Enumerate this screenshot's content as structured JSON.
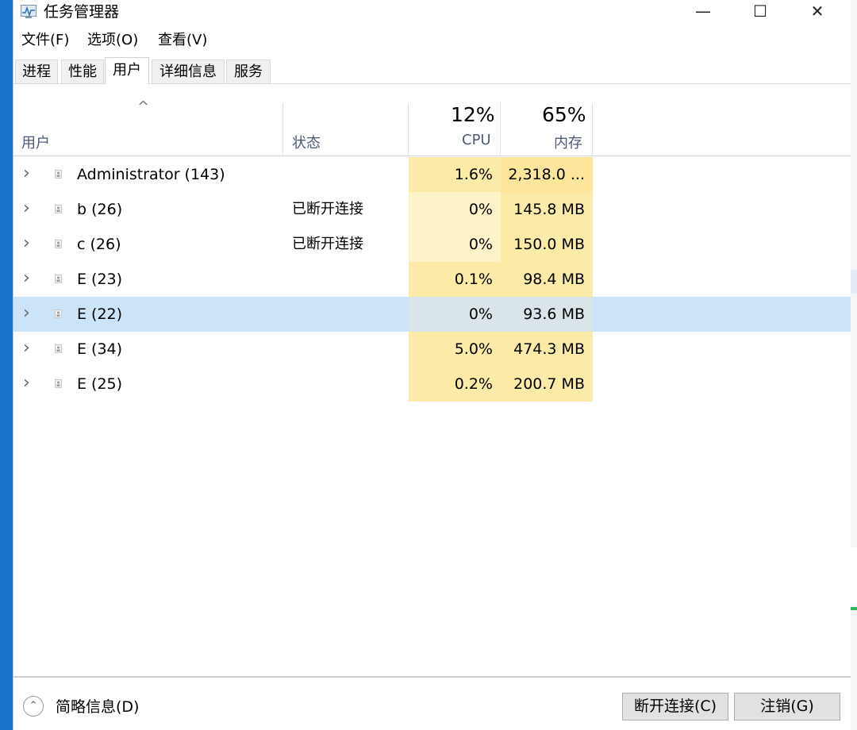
{
  "window": {
    "title": "任务管理器",
    "controls": {
      "minimize": "—",
      "maximize": "☐",
      "close": "✕"
    }
  },
  "menu": [
    "文件(F)",
    "选项(O)",
    "查看(V)"
  ],
  "tabs": [
    {
      "label": "进程",
      "active": false
    },
    {
      "label": "性能",
      "active": false
    },
    {
      "label": "用户",
      "active": true
    },
    {
      "label": "详细信息",
      "active": false
    },
    {
      "label": "服务",
      "active": false
    }
  ],
  "table": {
    "sort_indicator": "^",
    "columns": {
      "user": "用户",
      "status": "状态",
      "cpu": {
        "label": "CPU",
        "total": "12%"
      },
      "memory": {
        "label": "内存",
        "total": "65%"
      }
    },
    "rows": [
      {
        "name": "Administrator (143)",
        "status": "",
        "cpu": "1.6%",
        "memory": "2,318.0 ...",
        "selected": false,
        "cpu_heat": "#fbeba6",
        "mem_heat": "#fde59b"
      },
      {
        "name": "b (26)",
        "status": "已断开连接",
        "cpu": "0%",
        "memory": "145.8 MB",
        "selected": false,
        "cpu_heat": "#fdf3c8",
        "mem_heat": "#fbeba6"
      },
      {
        "name": "c (26)",
        "status": "已断开连接",
        "cpu": "0%",
        "memory": "150.0 MB",
        "selected": false,
        "cpu_heat": "#fdf3c8",
        "mem_heat": "#fbeba6"
      },
      {
        "name": "E (23)",
        "status": "",
        "cpu": "0.1%",
        "memory": "98.4 MB",
        "selected": false,
        "cpu_heat": "#fbeba6",
        "mem_heat": "#fbeba6"
      },
      {
        "name": "E (22)",
        "status": "",
        "cpu": "0%",
        "memory": "93.6 MB",
        "selected": true,
        "cpu_heat": "#dae5ea",
        "mem_heat": "#dae5ea"
      },
      {
        "name": "E (34)",
        "status": "",
        "cpu": "5.0%",
        "memory": "474.3 MB",
        "selected": false,
        "cpu_heat": "#fbeba6",
        "mem_heat": "#fbeba6"
      },
      {
        "name": "E (25)",
        "status": "",
        "cpu": "0.2%",
        "memory": "200.7 MB",
        "selected": false,
        "cpu_heat": "#fbeba6",
        "mem_heat": "#fbeba6"
      }
    ]
  },
  "footer": {
    "fewer_details": "简略信息(D)",
    "disconnect_button": "断开连接(C)",
    "logoff_button": "注销(G)"
  },
  "colors": {
    "selection": "#cce4f7",
    "header_label": "#4d5a78",
    "desktop": "#1a73c8"
  }
}
